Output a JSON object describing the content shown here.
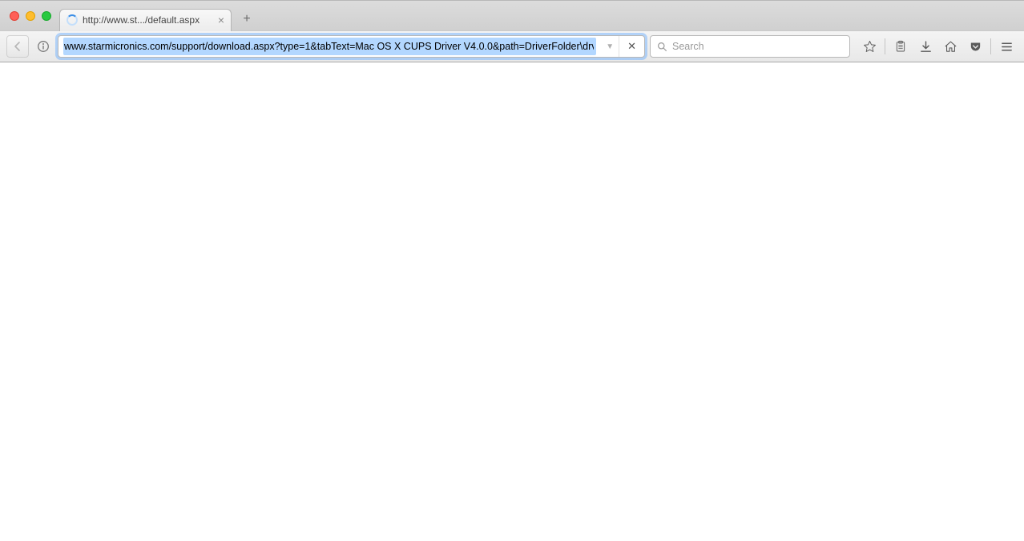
{
  "tab": {
    "title": "http://www.st.../default.aspx"
  },
  "urlbar": {
    "value": "www.starmicronics.com/support/download.aspx?type=1&tabText=Mac OS X CUPS Driver V4.0.0&path=DriverFolder\\drvr\\s"
  },
  "search": {
    "placeholder": "Search"
  }
}
